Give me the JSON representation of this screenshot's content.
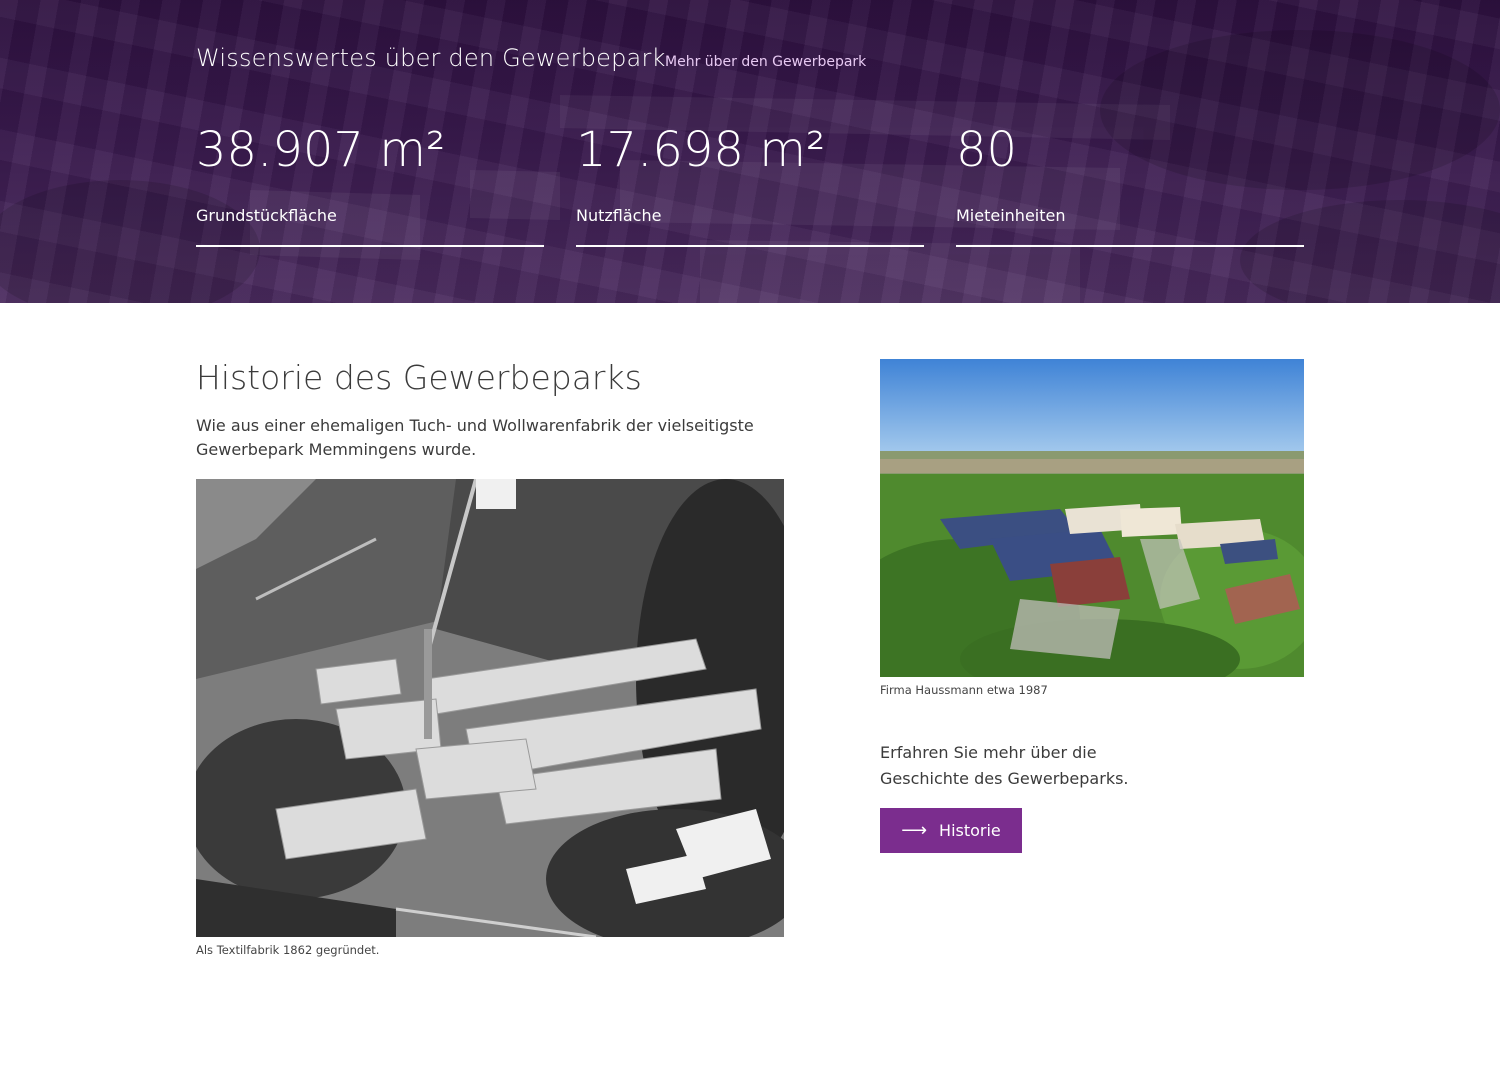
{
  "hero": {
    "title": "Wissenswertes über den Gewerbepark",
    "link_label": "Mehr über den Gewerbepark",
    "stats": [
      {
        "value": "38.907 m²",
        "label": "Grundstückfläche"
      },
      {
        "value": "17.698 m²",
        "label": "Nutzfläche"
      },
      {
        "value": "80",
        "label": "Mieteinheiten"
      }
    ]
  },
  "history": {
    "title": "Historie des Gewerbeparks",
    "intro": "Wie aus einer ehemaligen Tuch- und Wollwarenfabrik der vielseitigste Gewerbepark Memmingens wurde.",
    "photo_bw_caption": "Als Textilfabrik 1862 gegründet.",
    "photo_color_caption": "Firma Haussmann etwa 1987",
    "cta_text": "Erfahren Sie mehr über die Geschichte des Gewerbeparks.",
    "cta_label": "Historie",
    "cta_icon": "arrow-right-icon"
  },
  "colors": {
    "hero_bg": "#2e1140",
    "accent": "#7b2d8e",
    "link": "#e7c9f2"
  }
}
